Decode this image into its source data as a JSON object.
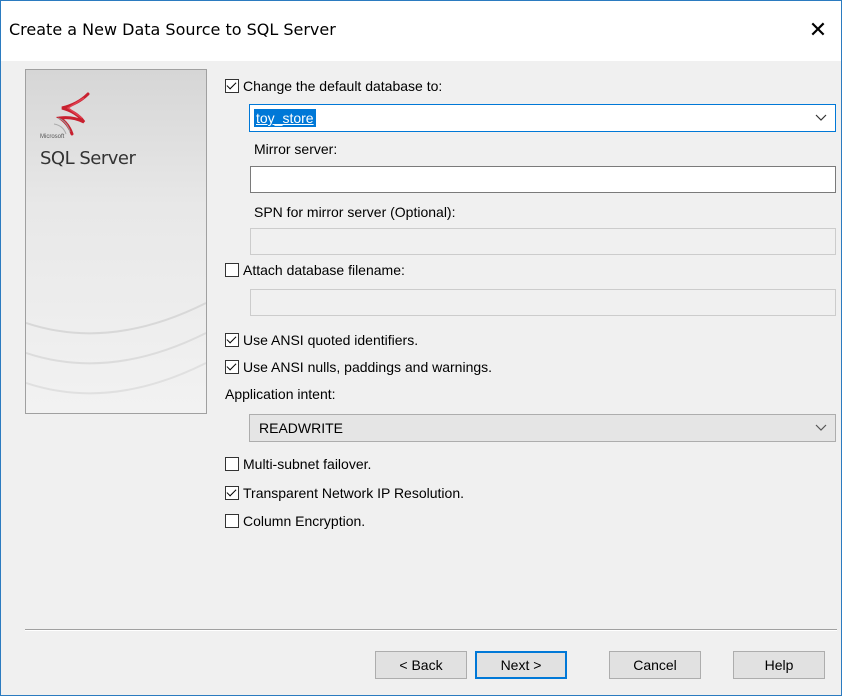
{
  "window": {
    "title": "Create a New Data Source to SQL Server",
    "close_glyph": "✕"
  },
  "side_panel": {
    "brand_small": "Microsoft",
    "product": "SQL Server"
  },
  "options": {
    "change_default_db": {
      "label": "Change the default database to:",
      "checked": true
    },
    "default_db_value": "toy_store",
    "mirror_server_label": "Mirror server:",
    "mirror_server_value": "",
    "spn_label": "SPN for mirror server (Optional):",
    "spn_value": "",
    "attach_db": {
      "label": "Attach database filename:",
      "checked": false
    },
    "attach_db_value": "",
    "ansi_quoted": {
      "label": "Use ANSI quoted identifiers.",
      "checked": true
    },
    "ansi_nulls": {
      "label": "Use ANSI nulls, paddings and warnings.",
      "checked": true
    },
    "app_intent_label": "Application intent:",
    "app_intent_value": "READWRITE",
    "multi_subnet": {
      "label": "Multi-subnet failover.",
      "checked": false
    },
    "transparent_ip": {
      "label": "Transparent Network IP Resolution.",
      "checked": true
    },
    "column_encryption": {
      "label": "Column Encryption.",
      "checked": false
    }
  },
  "buttons": {
    "back": "< Back",
    "next": "Next >",
    "cancel": "Cancel",
    "help": "Help"
  },
  "icons": {
    "dropdown": "chevron-down-icon",
    "close": "close-icon",
    "logo": "sql-server-logo-icon"
  },
  "colors": {
    "accent": "#0078d7",
    "window_border": "#2b7bc0",
    "background": "#f0f0f0"
  }
}
